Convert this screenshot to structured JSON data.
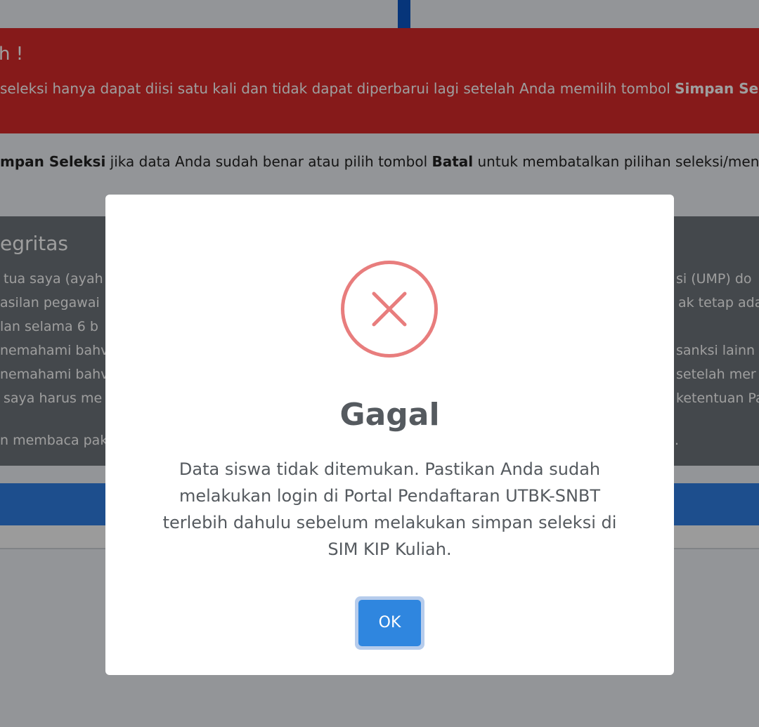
{
  "page": {
    "alert": {
      "title": "h !",
      "text_before": "seleksi hanya dapat diisi satu kali dan tidak dapat diperbarui lagi setelah Anda memilih tombol ",
      "text_bold": "Simpan Se"
    },
    "instruction": {
      "part1_bold": "mpan Seleksi",
      "part2": " jika data Anda sudah benar atau pilih tombol ",
      "part3_bold": "Batal",
      "part4": " untuk membatalkan pilihan seleksi/mengu"
    },
    "pakta": {
      "title": "egritas",
      "left_lines": [
        "tua saya (ayah",
        "asilan pegawai",
        "lan selama 6 b",
        "nemahami bahv",
        "nemahami bahv",
        "saya harus me",
        "n membaca pak"
      ],
      "right_lines": [
        "si (UMP) do",
        "ak tetap ada",
        "sanksi lainn",
        "setelah mer",
        "ketentuan Pa",
        "."
      ]
    }
  },
  "modal": {
    "icon": "x-circle-icon",
    "title": "Gagal",
    "message": "Data siswa tidak ditemukan. Pastikan Anda sudah melakukan login di Portal Pendaftaran UTBK-SNBT terlebih dahulu sebelum melakukan simpan seleksi di SIM KIP Kuliah.",
    "ok_label": "OK"
  },
  "colors": {
    "alert_red": "#d82a2a",
    "primary_blue": "#2f86df",
    "error_icon": "#e87d7d",
    "modal_text": "#555a5f"
  }
}
